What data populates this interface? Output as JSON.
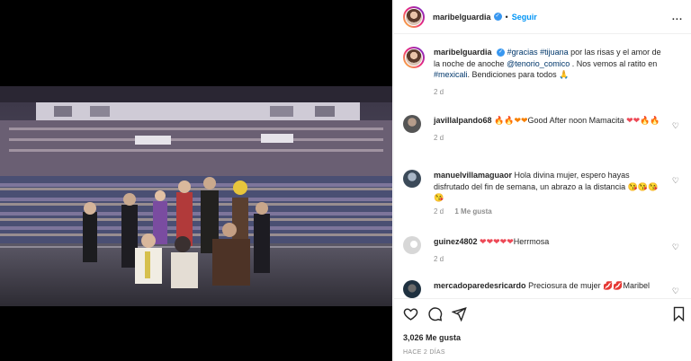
{
  "post": {
    "username": "maribelguardia",
    "follow_label": "Seguir",
    "more_label": "...",
    "caption_user": "maribelguardia",
    "caption_parts": {
      "hashtag1": "#gracias",
      "hashtag2": "#tijuana",
      "text1": " por las risas y el amor de la noche de anoche ",
      "mention": "@tenorio_comico",
      "text2": " . Nos vemos al ratito en ",
      "hashtag3": "#mexicali",
      "text3": ". Bendiciones para todos 🙏"
    },
    "caption_time": "2 d"
  },
  "comments": [
    {
      "user": "javillalpando68",
      "text_prefix": "🔥🔥❤❤",
      "text": "Good After noon Mamacita ",
      "text_suffix": "❤❤🔥🔥",
      "time": "2 d",
      "likes": ""
    },
    {
      "user": "manuelvillamaguaor",
      "text": "Hola divina mujer, espero hayas disfrutado del fin de semana, un abrazo a la distancia 😘😘😘😘",
      "time": "2 d",
      "likes": "1 Me gusta"
    },
    {
      "user": "guinez4802",
      "text_prefix": "❤❤❤❤❤",
      "text": "Herrmosa",
      "time": "2 d"
    },
    {
      "user": "mercadoparedesricardo",
      "text": "Preciosura de mujer 💋💋Maribel"
    }
  ],
  "footer": {
    "likes": "3,026 Me gusta",
    "time_ago": "HACE 2 DÍAS"
  },
  "icons": [
    "more-icon",
    "heart-icon",
    "comment-icon",
    "share-icon",
    "bookmark-icon",
    "verified-icon"
  ],
  "colors": {
    "accent": "#0095f6",
    "verified": "#3897f0",
    "link": "#00376b",
    "muted": "#8e8e8e"
  }
}
